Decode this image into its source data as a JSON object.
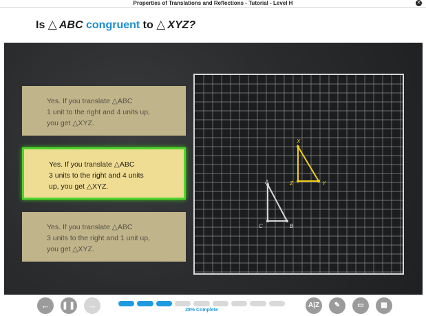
{
  "titlebar": {
    "title": "Properties of Translations and Reflections - Tutorial - Level H",
    "close_glyph": "✕"
  },
  "question": {
    "prefix": "Is",
    "triangle_symbol": "△",
    "shape1": "ABC",
    "congruent": "congruent",
    "to": "to",
    "shape2": "XYZ?"
  },
  "answers": [
    {
      "lines": [
        "Yes. If you translate △ABC",
        "1 unit to the right and 4 units up,",
        "you get △XYZ."
      ],
      "selected": false
    },
    {
      "lines": [
        "Yes. If you translate △ABC",
        "3 units to the right and 4 units",
        "up, you get △XYZ."
      ],
      "selected": true
    },
    {
      "lines": [
        "Yes. If you translate △ABC",
        "3 units to the right and 1 unit up,",
        "you get △XYZ."
      ],
      "selected": false
    }
  ],
  "graph": {
    "point_labels": {
      "A": "A",
      "B": "B",
      "C": "C",
      "X": "X",
      "Y": "Y",
      "Z": "Z"
    },
    "abc_color": "#d7d7d7",
    "xyz_color": "#f2cf1d"
  },
  "footer": {
    "back_icon": "←",
    "pause_icon": "❚❚",
    "forward_icon": "→",
    "progress_text": "28% Complete",
    "progress_fraction": 0.28,
    "tools": [
      "glossary-icon",
      "pencil-icon",
      "notepad-icon",
      "calculator-icon"
    ],
    "glossary_label": "A|Z"
  },
  "colors": {
    "accent": "#1a8fd0",
    "selected_border": "#4ed52a",
    "progress": "#1e9be0"
  }
}
